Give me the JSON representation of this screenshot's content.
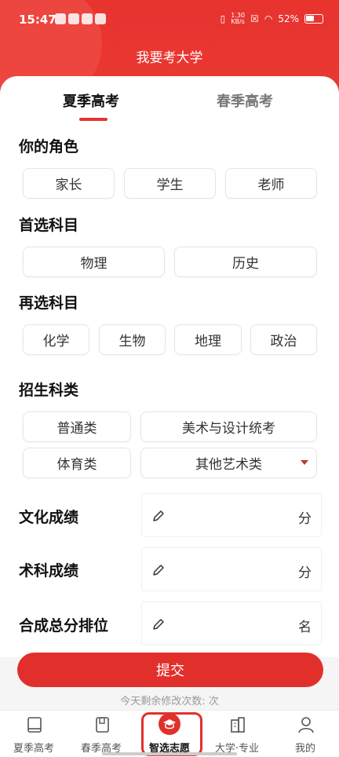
{
  "status": {
    "time": "15:47",
    "speed_top": "1.30",
    "speed_unit": "KB/s",
    "battery": "52%"
  },
  "header": {
    "title": "我要考大学"
  },
  "tabs": [
    {
      "label": "夏季高考",
      "active": true
    },
    {
      "label": "春季高考",
      "active": false
    }
  ],
  "role": {
    "heading": "你的角色",
    "options": [
      "家长",
      "学生",
      "老师"
    ]
  },
  "primary_subject": {
    "heading": "首选科目",
    "options": [
      "物理",
      "历史"
    ]
  },
  "secondary_subject": {
    "heading": "再选科目",
    "options": [
      "化学",
      "生物",
      "地理",
      "政治"
    ]
  },
  "enroll_type": {
    "heading": "招生科类",
    "options": [
      "普通类",
      "美术与设计统考",
      "体育类",
      "其他艺术类"
    ]
  },
  "scores": [
    {
      "label": "文化成绩",
      "unit": "分",
      "value": ""
    },
    {
      "label": "术科成绩",
      "unit": "分",
      "value": ""
    },
    {
      "label": "合成总分排位",
      "unit": "名",
      "value": ""
    }
  ],
  "submit_label": "提交",
  "remaining_text": "今天剩余修改次数:  次",
  "nav": [
    {
      "label": "夏季高考",
      "icon": "book-icon"
    },
    {
      "label": "春季高考",
      "icon": "notebook-icon"
    },
    {
      "label": "智选志愿",
      "icon": "graduation-cap-icon",
      "active": true
    },
    {
      "label": "大学·专业",
      "icon": "building-icon"
    },
    {
      "label": "我的",
      "icon": "person-icon"
    }
  ],
  "colors": {
    "accent": "#e1302b",
    "header": "#e8332f"
  }
}
